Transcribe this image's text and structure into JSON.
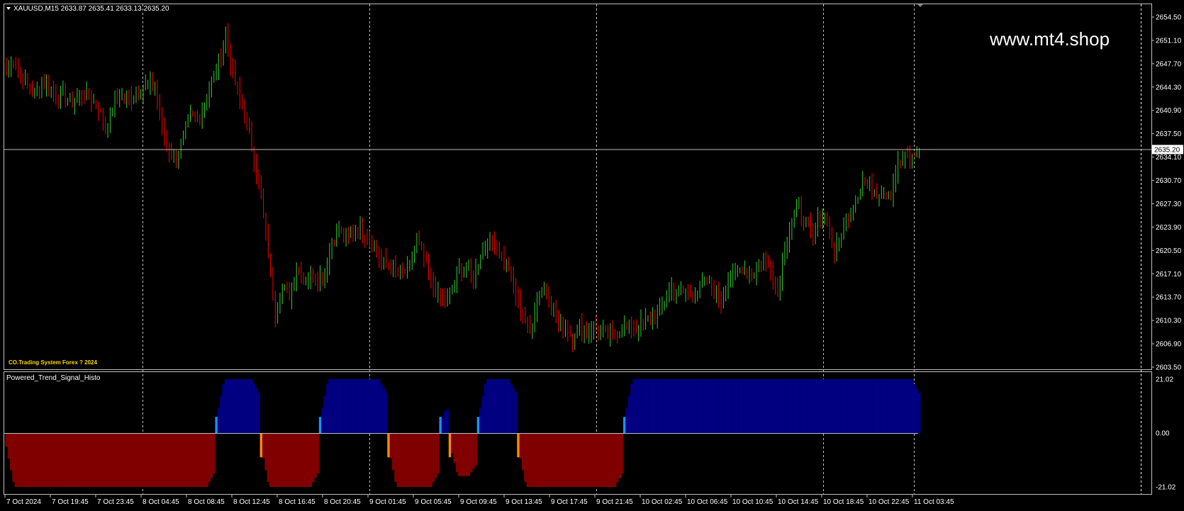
{
  "header": {
    "symbol_line": "XAUUSD,M15  2633.87 2635.41 2633.13 2635.20",
    "watermark": "www.mt4.shop",
    "credit": "CO.Trading System Forex  ? 2024",
    "indicator_name": "Powered_Trend_Signal_Histo"
  },
  "colors": {
    "background": "#000000",
    "bull_candle": "#32cd32",
    "bear_candle": "#ff0000",
    "histo_up": "#000080",
    "histo_down": "#800000",
    "signal_up": "#1e90ff",
    "signal_down": "#ff8c00",
    "credit": "#ffd700"
  },
  "chart_data": [
    {
      "type": "candlestick",
      "symbol": "XAUUSD",
      "timeframe": "M15",
      "current_price": "2635.20",
      "y_ticks": [
        "2654.50",
        "2651.10",
        "2647.70",
        "2644.30",
        "2640.90",
        "2637.50",
        "2634.10",
        "2630.70",
        "2627.30",
        "2623.90",
        "2620.50",
        "2617.10",
        "2613.70",
        "2610.30",
        "2606.90",
        "2603.50"
      ],
      "ylim": [
        2603.5,
        2654.5
      ],
      "x_ticks": [
        "7 Oct 2024",
        "7 Oct 19:45",
        "7 Oct 23:45",
        "8 Oct 04:45",
        "8 Oct 08:45",
        "8 Oct 12:45",
        "8 Oct 16:45",
        "8 Oct 20:45",
        "9 Oct 01:45",
        "9 Oct 05:45",
        "9 Oct 09:45",
        "9 Oct 13:45",
        "9 Oct 17:45",
        "9 Oct 21:45",
        "10 Oct 02:45",
        "10 Oct 06:45",
        "10 Oct 10:45",
        "10 Oct 14:45",
        "10 Oct 18:45",
        "10 Oct 22:45",
        "11 Oct 03:45"
      ],
      "close_path": [
        [
          0,
          2646.5
        ],
        [
          3,
          2648.5
        ],
        [
          6,
          2646
        ],
        [
          9,
          2644.5
        ],
        [
          12,
          2643.5
        ],
        [
          15,
          2645
        ],
        [
          18,
          2644
        ],
        [
          21,
          2643
        ],
        [
          24,
          2643.5
        ],
        [
          27,
          2642
        ],
        [
          30,
          2643
        ],
        [
          33,
          2643.2
        ],
        [
          36,
          2642.5
        ],
        [
          39,
          2641.5
        ],
        [
          42,
          2638
        ],
        [
          45,
          2641.5
        ],
        [
          48,
          2643
        ],
        [
          51,
          2642.5
        ],
        [
          54,
          2643
        ],
        [
          57,
          2644
        ],
        [
          60,
          2644.5
        ],
        [
          63,
          2644.5
        ],
        [
          66,
          2638
        ],
        [
          69,
          2635
        ],
        [
          72,
          2633.5
        ],
        [
          75,
          2637
        ],
        [
          78,
          2640
        ],
        [
          81,
          2640
        ],
        [
          84,
          2641.5
        ],
        [
          87,
          2645
        ],
        [
          90,
          2648
        ],
        [
          93,
          2652
        ],
        [
          96,
          2646
        ],
        [
          99,
          2642.5
        ],
        [
          102,
          2639
        ],
        [
          105,
          2634
        ],
        [
          108,
          2628
        ],
        [
          111,
          2620
        ],
        [
          114,
          2611.5
        ],
        [
          117,
          2615
        ],
        [
          120,
          2614
        ],
        [
          123,
          2618
        ],
        [
          126,
          2616
        ],
        [
          129,
          2617
        ],
        [
          132,
          2616.5
        ],
        [
          135,
          2617.5
        ],
        [
          138,
          2622
        ],
        [
          141,
          2623.5
        ],
        [
          144,
          2622
        ],
        [
          147,
          2623
        ],
        [
          150,
          2623.5
        ],
        [
          153,
          2622.5
        ],
        [
          156,
          2621
        ],
        [
          159,
          2619
        ],
        [
          162,
          2618
        ],
        [
          165,
          2617.5
        ],
        [
          168,
          2617
        ],
        [
          171,
          2618
        ],
        [
          174,
          2622
        ],
        [
          177,
          2619.5
        ],
        [
          180,
          2616
        ],
        [
          183,
          2614
        ],
        [
          186,
          2613
        ],
        [
          189,
          2615
        ],
        [
          192,
          2617.5
        ],
        [
          195,
          2618
        ],
        [
          198,
          2616.5
        ],
        [
          201,
          2620
        ],
        [
          204,
          2621.5
        ],
        [
          207,
          2622
        ],
        [
          210,
          2619.5
        ],
        [
          213,
          2618
        ],
        [
          216,
          2614
        ],
        [
          219,
          2611
        ],
        [
          222,
          2608.5
        ],
        [
          225,
          2614
        ],
        [
          228,
          2615.5
        ],
        [
          231,
          2612
        ],
        [
          234,
          2610
        ],
        [
          237,
          2609
        ],
        [
          240,
          2608
        ],
        [
          243,
          2609.5
        ],
        [
          246,
          2608.5
        ],
        [
          249,
          2609.5
        ],
        [
          252,
          2608.5
        ],
        [
          255,
          2608
        ],
        [
          258,
          2608.5
        ],
        [
          261,
          2609
        ],
        [
          264,
          2609.5
        ],
        [
          267,
          2609
        ],
        [
          270,
          2610
        ],
        [
          273,
          2610.5
        ],
        [
          276,
          2611
        ],
        [
          279,
          2613
        ],
        [
          282,
          2615
        ],
        [
          285,
          2614
        ],
        [
          288,
          2614.5
        ],
        [
          291,
          2614
        ],
        [
          294,
          2615
        ],
        [
          297,
          2616
        ],
        [
          300,
          2615
        ],
        [
          303,
          2613
        ],
        [
          306,
          2616
        ],
        [
          309,
          2617
        ],
        [
          312,
          2618
        ],
        [
          315,
          2617
        ],
        [
          318,
          2617.5
        ],
        [
          321,
          2619
        ],
        [
          324,
          2618
        ],
        [
          327,
          2614
        ],
        [
          330,
          2621
        ],
        [
          333,
          2625
        ],
        [
          336,
          2626.5
        ],
        [
          339,
          2624.5
        ],
        [
          342,
          2622
        ],
        [
          345,
          2626
        ],
        [
          348,
          2625
        ],
        [
          351,
          2620
        ],
        [
          354,
          2623
        ],
        [
          357,
          2626
        ],
        [
          360,
          2628
        ],
        [
          363,
          2630.5
        ],
        [
          366,
          2630
        ],
        [
          369,
          2629
        ],
        [
          372,
          2629
        ],
        [
          375,
          2629
        ],
        [
          378,
          2633
        ],
        [
          381,
          2634
        ],
        [
          384,
          2634
        ],
        [
          387,
          2635.2
        ]
      ]
    },
    {
      "type": "histogram",
      "name": "Powered_Trend_Signal_Histo",
      "y_ticks": [
        "21.02",
        "0.00",
        "-21.02"
      ],
      "ylim": [
        -21.02,
        21.02
      ],
      "segments": [
        {
          "start": 0,
          "end": 89,
          "direction": "down",
          "level": -21.02
        },
        {
          "start": 89,
          "end": 108,
          "direction": "up",
          "level": 21.02
        },
        {
          "start": 108,
          "end": 133,
          "direction": "down",
          "level": -21.02
        },
        {
          "start": 133,
          "end": 162,
          "direction": "up",
          "level": 21.02
        },
        {
          "start": 162,
          "end": 184,
          "direction": "down",
          "level": -21.02
        },
        {
          "start": 184,
          "end": 188,
          "direction": "up",
          "level": 12.5
        },
        {
          "start": 188,
          "end": 200,
          "direction": "down",
          "level": -16.8
        },
        {
          "start": 200,
          "end": 217,
          "direction": "up",
          "level": 21.02
        },
        {
          "start": 217,
          "end": 262,
          "direction": "down",
          "level": -21.02
        },
        {
          "start": 262,
          "end": 388,
          "direction": "up",
          "level": 21.02
        }
      ],
      "signals": [
        {
          "bar": 89,
          "type": "up"
        },
        {
          "bar": 108,
          "type": "down"
        },
        {
          "bar": 133,
          "type": "up"
        },
        {
          "bar": 162,
          "type": "down"
        },
        {
          "bar": 184,
          "type": "up"
        },
        {
          "bar": 188,
          "type": "down"
        },
        {
          "bar": 200,
          "type": "up"
        },
        {
          "bar": 217,
          "type": "down"
        },
        {
          "bar": 262,
          "type": "up"
        }
      ]
    }
  ]
}
